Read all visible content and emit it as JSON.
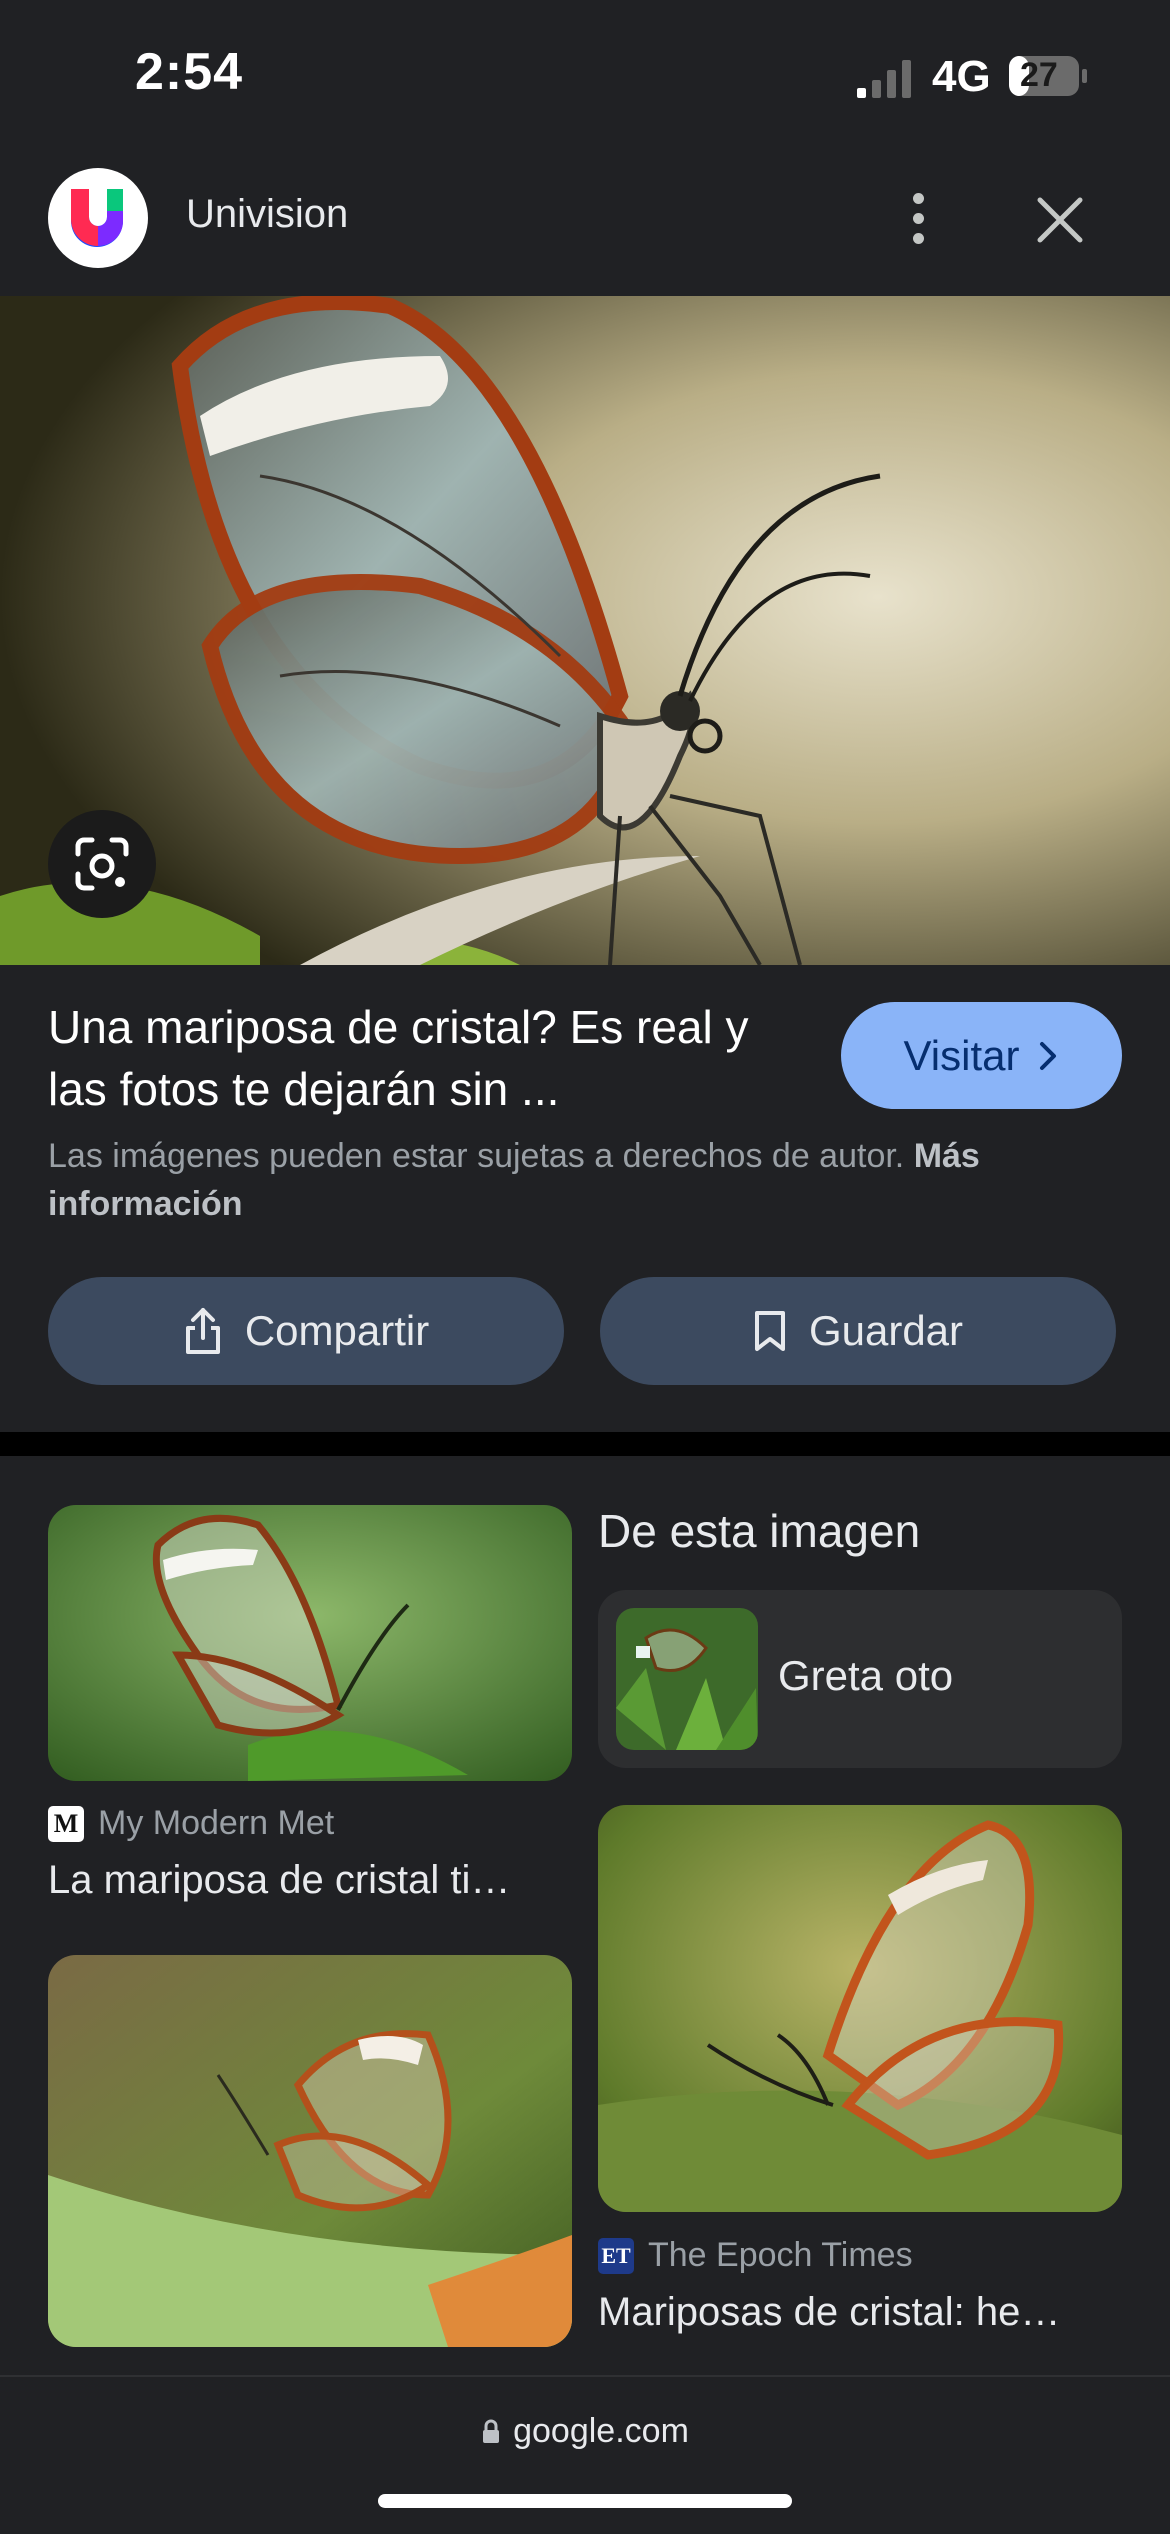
{
  "status_bar": {
    "time": "2:54",
    "network": "4G",
    "battery": "27"
  },
  "header": {
    "site_name": "Univision"
  },
  "result": {
    "title": "Una mariposa de cristal? Es real y las fotos te dejarán sin ...",
    "visit_label": "Visitar",
    "copyright_text": "Las imágenes pueden estar sujetas a derechos de autor.",
    "more_info_link": "Más información",
    "share_label": "Compartir",
    "save_label": "Guardar"
  },
  "related": {
    "section_title": "De esta imagen",
    "entity": {
      "label": "Greta oto"
    },
    "items": [
      {
        "source": "My Modern Met",
        "source_icon": "M",
        "title": "La mariposa de cristal ti…"
      },
      {
        "source": "The Epoch Times",
        "source_icon": "ET",
        "title": "Mariposas de cristal: he…"
      }
    ]
  },
  "bottom_bar": {
    "url": "google.com"
  },
  "colors": {
    "background": "#202124",
    "accent": "#8ab4f8",
    "button": "#3c4a5f"
  }
}
